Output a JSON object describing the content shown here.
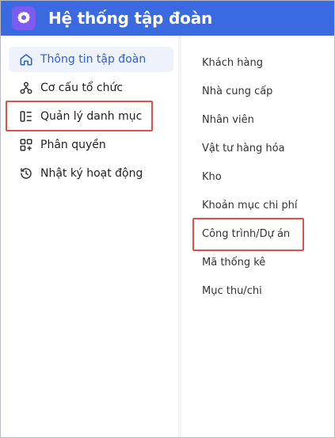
{
  "app": {
    "title": "Hệ thống tập đoàn",
    "accent_color": "#3b6ae0",
    "logo_color": "#7c5cf0",
    "highlight_color": "#d9534f"
  },
  "sidebar": {
    "items": [
      {
        "label": "Thông tin tập đoàn",
        "icon": "home-icon",
        "active": true
      },
      {
        "label": "Cơ cấu tổ chức",
        "icon": "org-structure-icon",
        "active": false
      },
      {
        "label": "Quản lý danh mục",
        "icon": "category-list-icon",
        "active": false,
        "highlighted": true
      },
      {
        "label": "Phân quyền",
        "icon": "grid-add-icon",
        "active": false
      },
      {
        "label": "Nhật ký hoạt động",
        "icon": "history-icon",
        "active": false
      }
    ]
  },
  "categories": {
    "items": [
      {
        "label": "Khách hàng"
      },
      {
        "label": "Nhà cung cấp"
      },
      {
        "label": "Nhân viên"
      },
      {
        "label": "Vật tư hàng hóa"
      },
      {
        "label": "Kho"
      },
      {
        "label": "Khoản mục chi phí"
      },
      {
        "label": "Công trình/Dự án",
        "highlighted": true
      },
      {
        "label": "Mã thống kê"
      },
      {
        "label": "Mục thu/chi"
      }
    ]
  }
}
